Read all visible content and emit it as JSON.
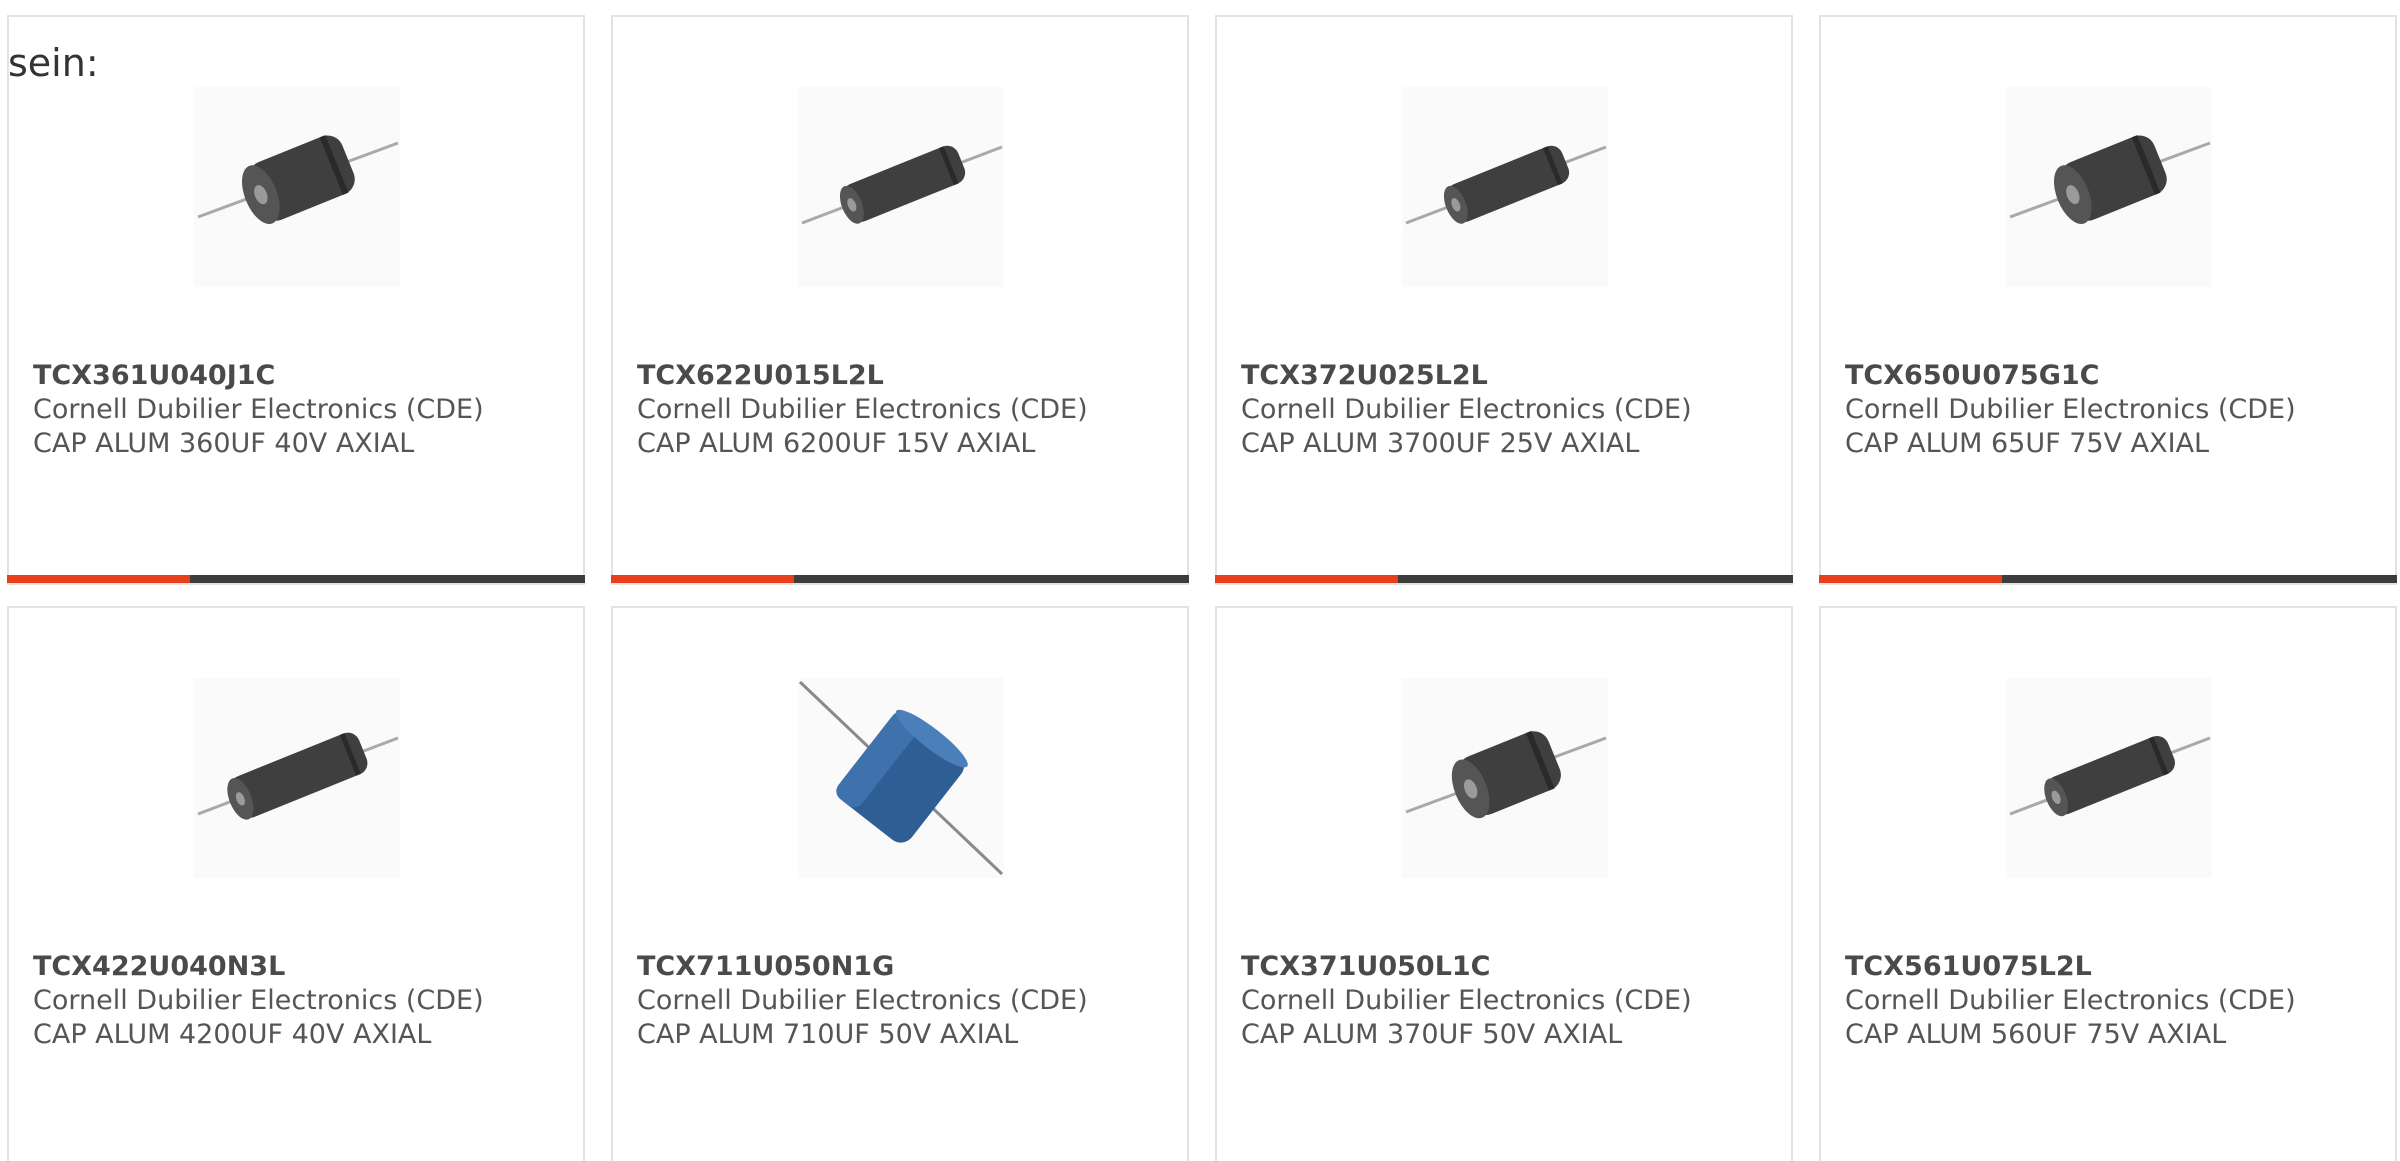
{
  "heading": "sein:",
  "colors": {
    "accent": "#e8401c",
    "bar": "#3c3c3c",
    "capacitor_black": "#3f3f3f",
    "capacitor_blue": "#2e5e94"
  },
  "products": [
    {
      "part": "TCX361U040J1C",
      "manufacturer": "Cornell Dubilier Electronics (CDE)",
      "description": "CAP ALUM 360UF 40V AXIAL",
      "image_icon": "axial-capacitor-icon"
    },
    {
      "part": "TCX622U015L2L",
      "manufacturer": "Cornell Dubilier Electronics (CDE)",
      "description": "CAP ALUM 6200UF 15V AXIAL",
      "image_icon": "axial-capacitor-icon"
    },
    {
      "part": "TCX372U025L2L",
      "manufacturer": "Cornell Dubilier Electronics (CDE)",
      "description": "CAP ALUM 3700UF 25V AXIAL",
      "image_icon": "axial-capacitor-icon"
    },
    {
      "part": "TCX650U075G1C",
      "manufacturer": "Cornell Dubilier Electronics (CDE)",
      "description": "CAP ALUM 65UF 75V AXIAL",
      "image_icon": "axial-capacitor-icon"
    },
    {
      "part": "TCX422U040N3L",
      "manufacturer": "Cornell Dubilier Electronics (CDE)",
      "description": "CAP ALUM 4200UF 40V AXIAL",
      "image_icon": "axial-capacitor-icon"
    },
    {
      "part": "TCX711U050N1G",
      "manufacturer": "Cornell Dubilier Electronics (CDE)",
      "description": "CAP ALUM 710UF 50V AXIAL",
      "image_icon": "blue-axial-capacitor-icon"
    },
    {
      "part": "TCX371U050L1C",
      "manufacturer": "Cornell Dubilier Electronics (CDE)",
      "description": "CAP ALUM 370UF 50V AXIAL",
      "image_icon": "axial-capacitor-icon"
    },
    {
      "part": "TCX561U075L2L",
      "manufacturer": "Cornell Dubilier Electronics (CDE)",
      "description": "CAP ALUM 560UF 75V AXIAL",
      "image_icon": "axial-capacitor-icon"
    }
  ]
}
